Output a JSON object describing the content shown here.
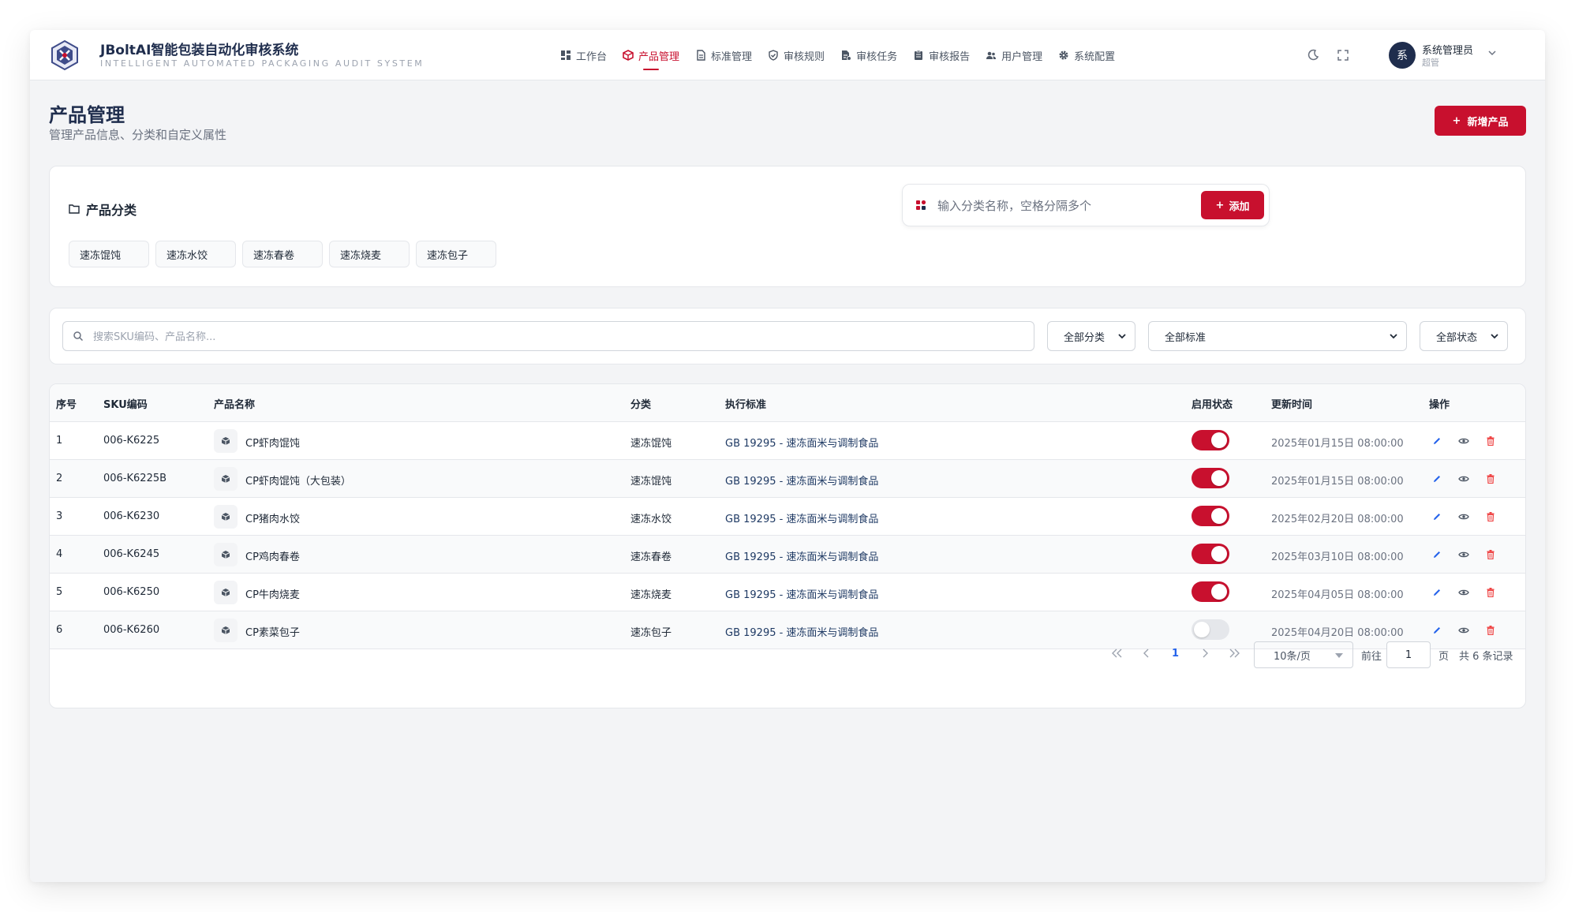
{
  "brand": {
    "title": "JBoltAI智能包装自动化审核系统",
    "subtitle": "INTELLIGENT AUTOMATED PACKAGING AUDIT SYSTEM"
  },
  "nav": [
    {
      "label": "工作台",
      "icon": "dashboard-icon",
      "active": false
    },
    {
      "label": "产品管理",
      "icon": "cube-icon",
      "active": true
    },
    {
      "label": "标准管理",
      "icon": "document-icon",
      "active": false
    },
    {
      "label": "审核规则",
      "icon": "shield-check-icon",
      "active": false
    },
    {
      "label": "审核任务",
      "icon": "task-file-icon",
      "active": false
    },
    {
      "label": "审核报告",
      "icon": "clipboard-icon",
      "active": false
    },
    {
      "label": "用户管理",
      "icon": "users-icon",
      "active": false
    },
    {
      "label": "系统配置",
      "icon": "gear-icon",
      "active": false
    }
  ],
  "user": {
    "avatar_text": "系",
    "name": "系统管理员",
    "role": "超管"
  },
  "page": {
    "title": "产品管理",
    "subtitle": "管理产品信息、分类和自定义属性",
    "new_button": "新增产品"
  },
  "categories": {
    "title": "产品分类",
    "tags": [
      "速冻馄饨",
      "速冻水饺",
      "速冻春卷",
      "速冻烧麦",
      "速冻包子"
    ],
    "input_placeholder": "输入分类名称，空格分隔多个",
    "add_button": "添加"
  },
  "filters": {
    "search_placeholder": "搜索SKU编码、产品名称...",
    "category_select": "全部分类",
    "standard_select": "全部标准",
    "status_select": "全部状态"
  },
  "table": {
    "columns": [
      "序号",
      "SKU编码",
      "产品名称",
      "分类",
      "执行标准",
      "启用状态",
      "更新时间",
      "操作"
    ],
    "rows": [
      {
        "index": "1",
        "sku": "006-K6225",
        "name": "CP虾肉馄饨",
        "category": "速冻馄饨",
        "standard": "GB 19295 - 速冻面米与调制食品",
        "enabled": true,
        "updated": "2025年01月15日 08:00:00"
      },
      {
        "index": "2",
        "sku": "006-K6225B",
        "name": "CP虾肉馄饨（大包装）",
        "category": "速冻馄饨",
        "standard": "GB 19295 - 速冻面米与调制食品",
        "enabled": true,
        "updated": "2025年01月15日 08:00:00"
      },
      {
        "index": "3",
        "sku": "006-K6230",
        "name": "CP猪肉水饺",
        "category": "速冻水饺",
        "standard": "GB 19295 - 速冻面米与调制食品",
        "enabled": true,
        "updated": "2025年02月20日 08:00:00"
      },
      {
        "index": "4",
        "sku": "006-K6245",
        "name": "CP鸡肉春卷",
        "category": "速冻春卷",
        "standard": "GB 19295 - 速冻面米与调制食品",
        "enabled": true,
        "updated": "2025年03月10日 08:00:00"
      },
      {
        "index": "5",
        "sku": "006-K6250",
        "name": "CP牛肉烧麦",
        "category": "速冻烧麦",
        "standard": "GB 19295 - 速冻面米与调制食品",
        "enabled": true,
        "updated": "2025年04月05日 08:00:00"
      },
      {
        "index": "6",
        "sku": "006-K6260",
        "name": "CP素菜包子",
        "category": "速冻包子",
        "standard": "GB 19295 - 速冻面米与调制食品",
        "enabled": false,
        "updated": "2025年04月20日 08:00:00"
      }
    ]
  },
  "pagination": {
    "current_page": "1",
    "page_size": "10条/页",
    "goto_label": "前往",
    "goto_value": "1",
    "page_unit": "页",
    "total_text": "共 6 条记录"
  },
  "colors": {
    "accent": "#c8102e",
    "navy": "#1f2d4d",
    "link_blue": "#2563eb",
    "delete_red": "#ef4444"
  }
}
